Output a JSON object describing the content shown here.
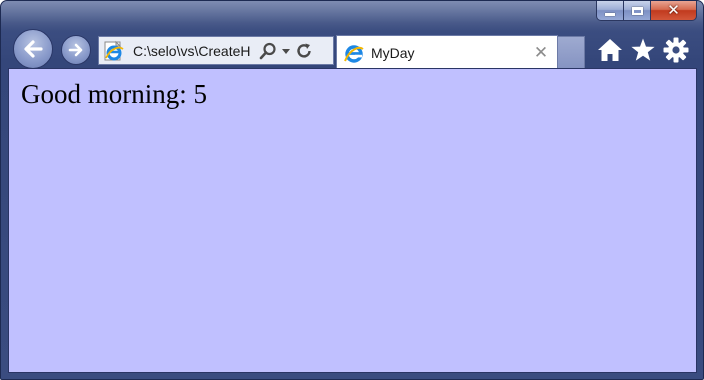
{
  "window": {
    "caption": {
      "minimize_icon": "minimize-icon",
      "maximize_icon": "maximize-icon",
      "close_glyph": "✕"
    }
  },
  "nav": {
    "back_icon": "back-arrow-icon",
    "forward_icon": "forward-arrow-icon"
  },
  "address_bar": {
    "value": "C:\\selo\\vs\\CreateH",
    "site_icon": "ie-logo-icon",
    "tools": [
      "search-icon",
      "dropdown-arrow-icon",
      "refresh-icon"
    ]
  },
  "tabs": [
    {
      "title": "MyDay",
      "icon": "ie-logo-icon",
      "close_glyph": "✕",
      "active": true
    }
  ],
  "toolbar": [
    "home-icon",
    "favorites-star-icon",
    "settings-gear-icon"
  ],
  "page": {
    "greeting": "Good morning: 5",
    "background": "#c0c0ff"
  },
  "colors": {
    "frame": "#3d4f82",
    "close_button": "#c13a1e",
    "tab_background": "#ffffff"
  }
}
